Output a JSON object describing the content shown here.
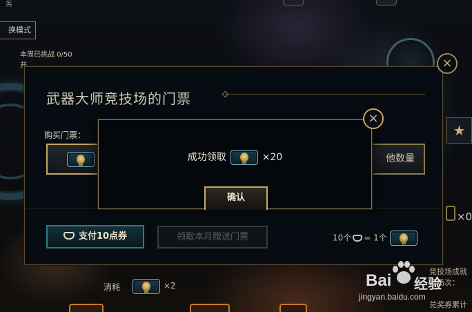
{
  "background": {
    "top_cut_text": "务",
    "mode_button": "换模式",
    "weekly_challenge": "本周已挑战 0/50",
    "weekly_line2": "开",
    "consume_label": "消耗",
    "consume_count": "×2",
    "right_partial_count": "×0",
    "right_text_1": "竞技场成就",
    "right_text_2": "门场次：",
    "right_text_3": "兑奖券累计"
  },
  "dialog": {
    "title": "武器大师竞技场的门票",
    "buy_label": "购买门票：",
    "option_right_label": "他数量",
    "pay_button": "支付10点券",
    "claim_button": "领取本月赠送门票",
    "exchange_left": "10个",
    "exchange_right": "= 1个"
  },
  "popup": {
    "message_prefix": "成功领取",
    "message_count": "×20",
    "confirm_button": "确认"
  },
  "watermark": {
    "brand": "Bai",
    "brand_suffix": "经验",
    "url": "jingyan.baidu.com"
  },
  "icons": {
    "ticket": "arena-ticket-icon",
    "pay": "voucher-icon",
    "close": "close-icon"
  },
  "colors": {
    "gold_border": "#c8a860",
    "teal_button": "#2a7c88",
    "dialog_bg": "#070c12"
  }
}
